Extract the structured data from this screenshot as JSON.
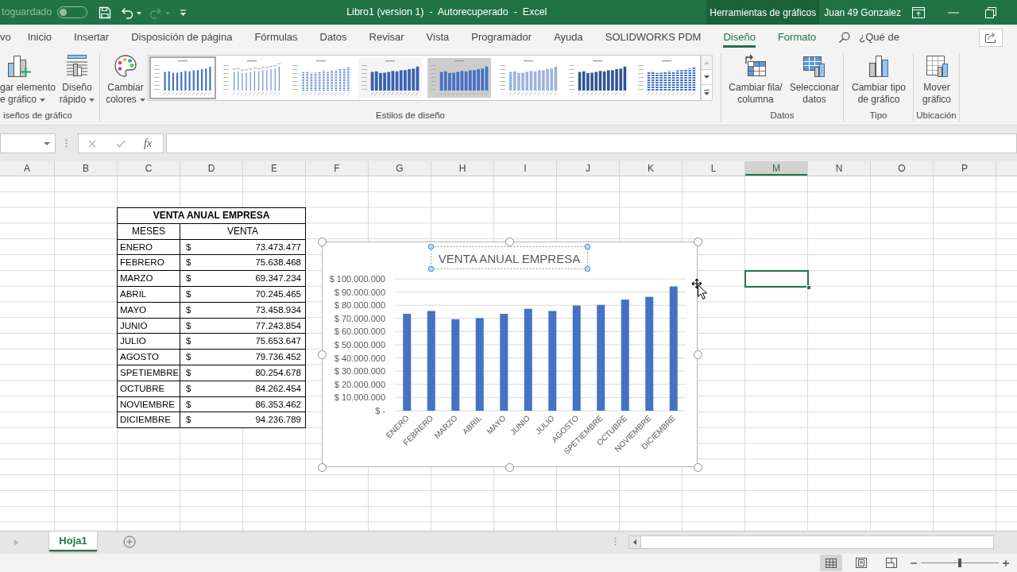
{
  "title_bar": {
    "autosave_label": "toguardado",
    "autosave_on": false,
    "title": "Libro1 (version 1)  -  Autorecuperado  -  Excel",
    "context_label": "Herramientas de gráficos",
    "user": "Juan 49 Gonzalez"
  },
  "quick_access": [
    {
      "kind": "save",
      "disabled": false
    },
    {
      "kind": "undo",
      "disabled": false
    },
    {
      "kind": "redo",
      "disabled": true
    },
    {
      "kind": "customize",
      "disabled": false
    }
  ],
  "ribbon_tabs": [
    {
      "label": "vo",
      "kind": "standard",
      "selected": false
    },
    {
      "label": "Inicio",
      "kind": "standard",
      "selected": false
    },
    {
      "label": "Insertar",
      "kind": "standard",
      "selected": false
    },
    {
      "label": "Disposición de página",
      "kind": "standard",
      "selected": false
    },
    {
      "label": "Fórmulas",
      "kind": "standard",
      "selected": false
    },
    {
      "label": "Datos",
      "kind": "standard",
      "selected": false
    },
    {
      "label": "Revisar",
      "kind": "standard",
      "selected": false
    },
    {
      "label": "Vista",
      "kind": "standard",
      "selected": false
    },
    {
      "label": "Programador",
      "kind": "standard",
      "selected": false
    },
    {
      "label": "Ayuda",
      "kind": "standard",
      "selected": false
    },
    {
      "label": "SOLIDWORKS PDM",
      "kind": "standard",
      "selected": false
    },
    {
      "label": "Diseño",
      "kind": "contextual",
      "selected": true
    },
    {
      "label": "Formato",
      "kind": "contextual",
      "selected": false
    }
  ],
  "tell_me": {
    "label": "¿Qué de"
  },
  "ribbon_groups": [
    {
      "label": "iseños de gráfico",
      "commands": [
        {
          "kind": "add_element",
          "lines": [
            "gar elemento",
            "e gráfico"
          ],
          "dropdown": true
        },
        {
          "kind": "quick_layout",
          "lines": [
            "Diseño",
            "rápido"
          ],
          "dropdown": true
        }
      ]
    },
    {
      "label": "Estilos de diseño",
      "commands": [
        {
          "kind": "change_colors",
          "lines": [
            "Cambiar",
            "colores"
          ],
          "dropdown": true
        }
      ],
      "gallery": [
        {
          "kind": "plain",
          "selected": true
        },
        {
          "kind": "labels",
          "selected": false
        },
        {
          "kind": "dotted",
          "selected": false
        },
        {
          "kind": "bold",
          "selected": false
        },
        {
          "kind": "shaded",
          "selected": false
        },
        {
          "kind": "light",
          "selected": false
        },
        {
          "kind": "dark",
          "selected": false
        },
        {
          "kind": "hatched",
          "selected": false
        }
      ]
    },
    {
      "label": "Datos",
      "commands": [
        {
          "kind": "switch_row_column",
          "lines": [
            "Cambiar fila/",
            "columna"
          ],
          "dropdown": false
        },
        {
          "kind": "select_data",
          "lines": [
            "Seleccionar",
            "datos"
          ],
          "dropdown": false
        }
      ]
    },
    {
      "label": "Tipo",
      "commands": [
        {
          "kind": "change_chart_type",
          "lines": [
            "Cambiar tipo",
            "de gráfico"
          ],
          "dropdown": false
        }
      ]
    },
    {
      "label": "Ubicación",
      "commands": [
        {
          "kind": "move_chart",
          "lines": [
            "Mover",
            "gráfico"
          ],
          "dropdown": false
        }
      ]
    }
  ],
  "formula_bar": {
    "function_label": "fx"
  },
  "columns": [
    {
      "label": "A",
      "selected": false
    },
    {
      "label": "B",
      "selected": false
    },
    {
      "label": "C",
      "selected": false
    },
    {
      "label": "D",
      "selected": false
    },
    {
      "label": "E",
      "selected": false
    },
    {
      "label": "F",
      "selected": false
    },
    {
      "label": "G",
      "selected": false
    },
    {
      "label": "H",
      "selected": false
    },
    {
      "label": "I",
      "selected": false
    },
    {
      "label": "J",
      "selected": false
    },
    {
      "label": "K",
      "selected": false
    },
    {
      "label": "L",
      "selected": false
    },
    {
      "label": "M",
      "selected": true
    },
    {
      "label": "N",
      "selected": false
    },
    {
      "label": "O",
      "selected": false
    },
    {
      "label": "P",
      "selected": false
    }
  ],
  "table": {
    "title": "VENTA ANUAL EMPRESA",
    "headers": [
      "MESES",
      "VENTA"
    ],
    "rows": [
      {
        "month": "ENERO",
        "currency": "$",
        "amount": "73.473.477"
      },
      {
        "month": "FEBRERO",
        "currency": "$",
        "amount": "75.638.468"
      },
      {
        "month": "MARZO",
        "currency": "$",
        "amount": "69.347.234"
      },
      {
        "month": "ABRIL",
        "currency": "$",
        "amount": "70.245.465"
      },
      {
        "month": "MAYO",
        "currency": "$",
        "amount": "73.458.934"
      },
      {
        "month": "JUNIO",
        "currency": "$",
        "amount": "77.243.854"
      },
      {
        "month": "JULIO",
        "currency": "$",
        "amount": "75.653.647"
      },
      {
        "month": "AGOSTO",
        "currency": "$",
        "amount": "79.736.452"
      },
      {
        "month": "SPETIEMBRE",
        "currency": "$",
        "amount": "80.254.678"
      },
      {
        "month": "OCTUBRE",
        "currency": "$",
        "amount": "84.262.454"
      },
      {
        "month": "NOVIEMBRE",
        "currency": "$",
        "amount": "86.353.462"
      },
      {
        "month": "DICIEMBRE",
        "currency": "$",
        "amount": "94.236.789"
      }
    ]
  },
  "chart": {
    "selected": true,
    "title_selected": true,
    "chart_data": [
      {
        "type": "bar",
        "title": "VENTA ANUAL EMPRESA",
        "categories": [
          "ENERO",
          "FEBRERO",
          "MARZO",
          "ABRIL",
          "MAYO",
          "JUNIO",
          "JULIO",
          "AGOSTO",
          "SPETIEMBRE",
          "OCTUBRE",
          "NOVIEMBRE",
          "DICIEMBRE"
        ],
        "values": [
          73473477,
          75638468,
          69347234,
          70245465,
          73458934,
          77243854,
          75653647,
          79736452,
          80254678,
          84262454,
          86353462,
          94236789
        ],
        "color": "#4472c4",
        "ylim": [
          0,
          100000000
        ],
        "yticks": [
          {
            "value": 100000000,
            "label": "$ 100.000.000"
          },
          {
            "value": 90000000,
            "label": "$ 90.000.000"
          },
          {
            "value": 80000000,
            "label": "$ 80.000.000"
          },
          {
            "value": 70000000,
            "label": "$ 70.000.000"
          },
          {
            "value": 60000000,
            "label": "$ 60.000.000"
          },
          {
            "value": 50000000,
            "label": "$ 50.000.000"
          },
          {
            "value": 40000000,
            "label": "$ 40.000.000"
          },
          {
            "value": 30000000,
            "label": "$ 30.000.000"
          },
          {
            "value": 20000000,
            "label": "$ 20.000.000"
          },
          {
            "value": 10000000,
            "label": "$ 10.000.000"
          },
          {
            "value": 0,
            "label": "$ -"
          }
        ],
        "grid": true
      }
    ]
  },
  "sheet_tabs": [
    {
      "label": "Hoja1",
      "selected": true
    }
  ],
  "status_bar": {
    "views": [
      {
        "kind": "normal",
        "selected": true
      },
      {
        "kind": "page_layout",
        "selected": false
      },
      {
        "kind": "page_break_preview",
        "selected": false
      }
    ],
    "zoom": {
      "level": 0.5
    }
  }
}
